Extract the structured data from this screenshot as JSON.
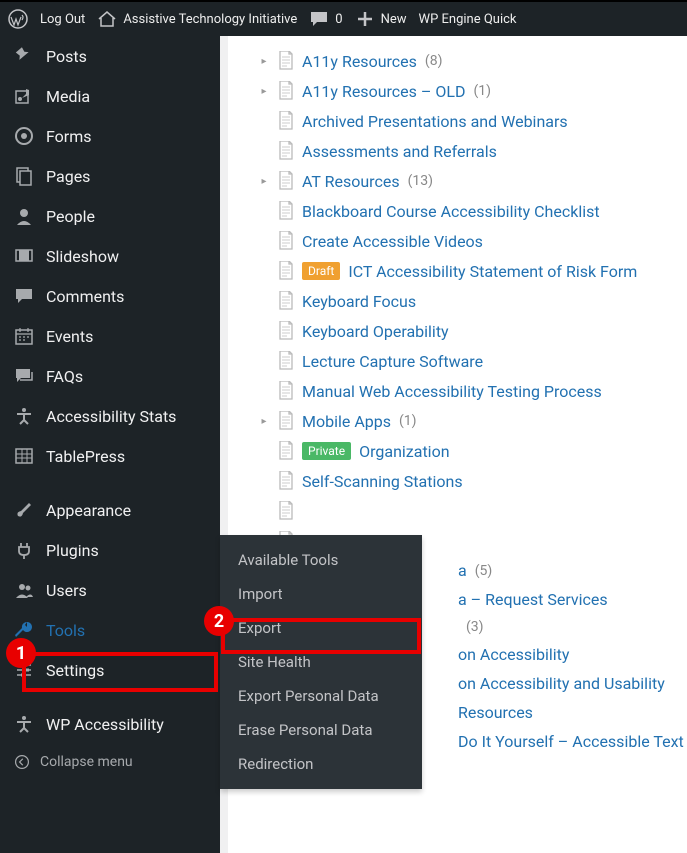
{
  "toolbar": {
    "logout": "Log Out",
    "site_name": "Assistive Technology Initiative",
    "comments_count": "0",
    "new_label": "New",
    "quick": "WP Engine Quick"
  },
  "sidebar": {
    "items": [
      {
        "label": "Posts",
        "icon": "pin"
      },
      {
        "label": "Media",
        "icon": "media"
      },
      {
        "label": "Forms",
        "icon": "forms"
      },
      {
        "label": "Pages",
        "icon": "pages"
      },
      {
        "label": "People",
        "icon": "user"
      },
      {
        "label": "Slideshow",
        "icon": "slideshow"
      },
      {
        "label": "Comments",
        "icon": "chat"
      },
      {
        "label": "Events",
        "icon": "calendar"
      },
      {
        "label": "FAQs",
        "icon": "faq"
      },
      {
        "label": "Accessibility Stats",
        "icon": "a11y"
      },
      {
        "label": "TablePress",
        "icon": "table"
      },
      {
        "label": "Appearance",
        "icon": "brush"
      },
      {
        "label": "Plugins",
        "icon": "plug"
      },
      {
        "label": "Users",
        "icon": "users"
      },
      {
        "label": "Tools",
        "icon": "wrench",
        "active": true
      },
      {
        "label": "Settings",
        "icon": "sliders"
      },
      {
        "label": "WP Accessibility",
        "icon": "a11y"
      }
    ],
    "collapse": "Collapse menu"
  },
  "flyout": {
    "items": [
      "Available Tools",
      "Import",
      "Export",
      "Site Health",
      "Export Personal Data",
      "Erase Personal Data",
      "Redirection"
    ]
  },
  "pages": [
    {
      "title": "A11y Resources",
      "count": "(8)",
      "expandable": true
    },
    {
      "title": "A11y Resources – OLD",
      "count": "(1)",
      "expandable": true
    },
    {
      "title": "Archived Presentations and Webinars"
    },
    {
      "title": "Assessments and Referrals"
    },
    {
      "title": "AT Resources",
      "count": "(13)",
      "expandable": true
    },
    {
      "title": "Blackboard Course Accessibility Checklist"
    },
    {
      "title": "Create Accessible Videos"
    },
    {
      "title": "ICT Accessibility Statement of Risk Form",
      "badge": "Draft",
      "badgecls": "draft"
    },
    {
      "title": "Keyboard Focus"
    },
    {
      "title": "Keyboard Operability"
    },
    {
      "title": "Lecture Capture Software"
    },
    {
      "title": "Manual Web Accessibility Testing Process"
    },
    {
      "title": "Mobile Apps",
      "count": "(1)",
      "expandable": true
    },
    {
      "title": "Organization",
      "badge": "Private",
      "badgecls": "private"
    },
    {
      "title": "Self-Scanning Stations"
    },
    {
      "title": ""
    },
    {
      "title": ""
    },
    {
      "title": "a",
      "count": "(5)",
      "partial": true
    },
    {
      "title": "a – Request Services",
      "partial": true
    },
    {
      "title": "",
      "count": "(3)",
      "partial": true
    },
    {
      "title": "on Accessibility",
      "partial": true
    },
    {
      "title": "on Accessibility and Usability",
      "partial": true
    },
    {
      "title": " Resources",
      "partial": true
    },
    {
      "title": "Do It Yourself – Accessible Text",
      "partial": true
    }
  ],
  "markers": {
    "one": "1",
    "two": "2"
  }
}
